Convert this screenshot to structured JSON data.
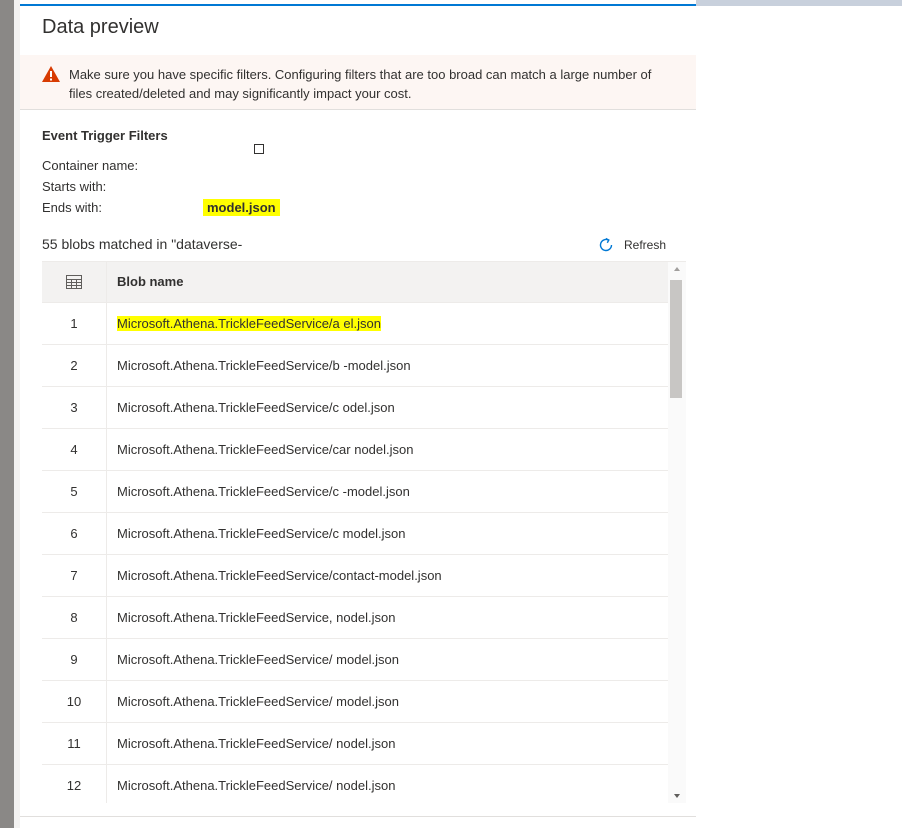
{
  "panel": {
    "title": "Data preview",
    "warning": "Make sure you have specific filters. Configuring filters that are too broad can match a large number of files created/deleted and may significantly impact your cost."
  },
  "filters": {
    "section_title": "Event Trigger Filters",
    "container_label": "Container name:",
    "starts_label": "Starts with:",
    "ends_label": "Ends with:",
    "ends_value": "model.json"
  },
  "results": {
    "matched_text": "55 blobs matched in \"dataverse-",
    "refresh_label": "Refresh"
  },
  "grid": {
    "column_header": "Blob name",
    "rows": [
      {
        "num": "1",
        "name": "Microsoft.Athena.TrickleFeedService/a                    el.json"
      },
      {
        "num": "2",
        "name": "Microsoft.Athena.TrickleFeedService/b               -model.json"
      },
      {
        "num": "3",
        "name": "Microsoft.Athena.TrickleFeedService/c               odel.json"
      },
      {
        "num": "4",
        "name": "Microsoft.Athena.TrickleFeedService/car                 nodel.json"
      },
      {
        "num": "5",
        "name": "Microsoft.Athena.TrickleFeedService/c                   -model.json"
      },
      {
        "num": "6",
        "name": "Microsoft.Athena.TrickleFeedService/c                   model.json"
      },
      {
        "num": "7",
        "name": "Microsoft.Athena.TrickleFeedService/contact-model.json"
      },
      {
        "num": "8",
        "name": "Microsoft.Athena.TrickleFeedService,      nodel.json"
      },
      {
        "num": "9",
        "name": "Microsoft.Athena.TrickleFeedService/                    model.json"
      },
      {
        "num": "10",
        "name": "Microsoft.Athena.TrickleFeedService/                       model.json"
      },
      {
        "num": "11",
        "name": "Microsoft.Athena.TrickleFeedService/                   nodel.json"
      },
      {
        "num": "12",
        "name": "Microsoft.Athena.TrickleFeedService/                       nodel.json"
      }
    ]
  },
  "colors": {
    "accent": "#0078d4",
    "warning_icon": "#d83b01",
    "highlight": "#ffff00"
  },
  "icons": {
    "warning": "warning-triangle-icon",
    "refresh": "refresh-icon",
    "table": "table-grid-icon"
  }
}
